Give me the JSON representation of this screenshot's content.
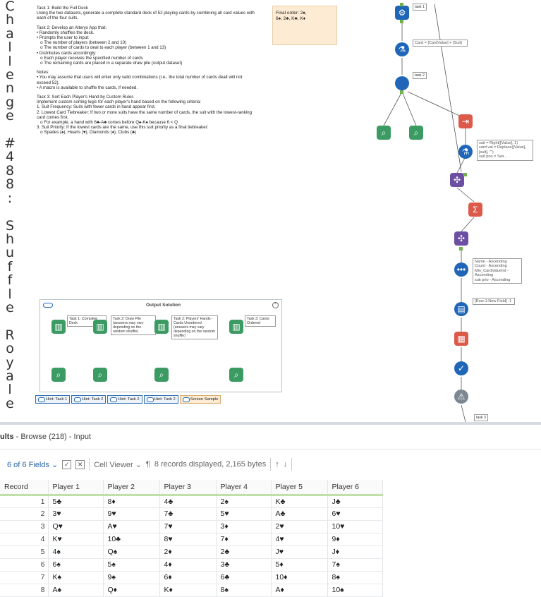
{
  "sidebar_title": "Challenge #488: Shuffle Royale",
  "task_text": {
    "t1_title": "Task 1: Build the Full Deck",
    "t1_body": "Using the two datasets, generate a complete standard deck of 52 playing cards by combining all card values with each of the four suits.",
    "t2_title": "Task 2: Develop an Alteryx App that:",
    "t2_lines": [
      "• Randomly shuffles the deck.",
      "• Prompts the user to input:",
      "   o The number of players (between 2 and 10)",
      "   o The number of cards to deal to each player (between 1 and 13)",
      "• Distributes cards accordingly:",
      "   o Each player receives the specified number of cards",
      "   o The remaining cards are placed in a separate draw pile (output dataset)"
    ],
    "notes_title": "Notes:",
    "notes_lines": [
      "• You may assume that users will enter only valid combinations (i.e., the total number of cards dealt will not exceed 52).",
      "• A macro is available to shuffle the cards, if needed."
    ],
    "t3_title": "Task 3: Sort Each Player's Hand by Custom Rules",
    "t3_lines": [
      "Implement custom sorting logic for each player's hand based on the following criteria:",
      "1. Suit Frequency: Suits with fewer cards in hand appear first.",
      "2. Lowest Card Tiebreaker: If two or more suits have the same number of cards, the suit with the lowest-ranking card comes first.",
      "   o For example, a hand with 6♣-A♣ comes before Q♠-K♠ because 6 < Q.",
      "3. Suit Priority: If the lowest cards are the same, use this suit priority as a final tiebreaker:",
      "   o Spades (♠), Hearts (♥), Diamonds (♦), Clubs (♣)"
    ]
  },
  "final_order": {
    "label": "Final order: 2♠,",
    "line2": "6♠, 2♣, K♣, K♦"
  },
  "workflow": {
    "task1_label": "task 1",
    "task2_label": "task 2",
    "task3_label": "task 3",
    "formula1": "Card = [CardValue] + [Suit]",
    "formula2": "suit = Right([Value], 1)\ncard val = Replace([Value], [suit], \"\")\nsuit prio = Swi...",
    "sort_text": "Name - Ascending\nCount - Ascending\nMin_CardValueInt - Ascending\nsuit prio - Ascending",
    "multirow_text": "[Row-1:New Field] -1",
    "container_title": "Output Solution",
    "browse1": "Task 1: Complete Deck",
    "browse2": "Task 2: Draw Pile (answers may vary depending on the random shuffle)",
    "browse3": "Task 2: Players' Hands - Cards Unordered (answers may vary depending on the random shuffle)",
    "browse4": "Task 3: Cards Ordered",
    "hints": [
      "Hint: Task 1",
      "Hint: Task 2",
      "Hint: Task 2",
      "Hint: Task 2",
      "Screen Sample"
    ]
  },
  "results": {
    "title": "ults",
    "subtitle": " - Browse (218) - Input",
    "fields_label": "6 of 6 Fields",
    "viewer_label": "Cell Viewer",
    "records_info": "8 records displayed, 2,165 bytes",
    "columns": [
      "Record",
      "Player 1",
      "Player 2",
      "Player 3",
      "Player 4",
      "Player 5",
      "Player 6"
    ],
    "rows": [
      [
        "1",
        "5♣",
        "8♦",
        "4♣",
        "2♠",
        "K♣",
        "J♣"
      ],
      [
        "2",
        "3♥",
        "9♥",
        "7♣",
        "5♥",
        "A♣",
        "6♥"
      ],
      [
        "3",
        "Q♥",
        "A♥",
        "7♥",
        "3♦",
        "2♥",
        "10♥"
      ],
      [
        "4",
        "K♥",
        "10♣",
        "8♥",
        "7♦",
        "4♥",
        "9♦"
      ],
      [
        "5",
        "4♠",
        "Q♠",
        "2♦",
        "2♣",
        "J♥",
        "J♦"
      ],
      [
        "6",
        "6♠",
        "5♠",
        "4♦",
        "3♣",
        "5♦",
        "7♠"
      ],
      [
        "7",
        "K♠",
        "9♠",
        "6♦",
        "6♣",
        "10♦",
        "8♠"
      ],
      [
        "8",
        "A♠",
        "Q♦",
        "K♦",
        "8♠",
        "A♦",
        "10♠"
      ]
    ]
  }
}
